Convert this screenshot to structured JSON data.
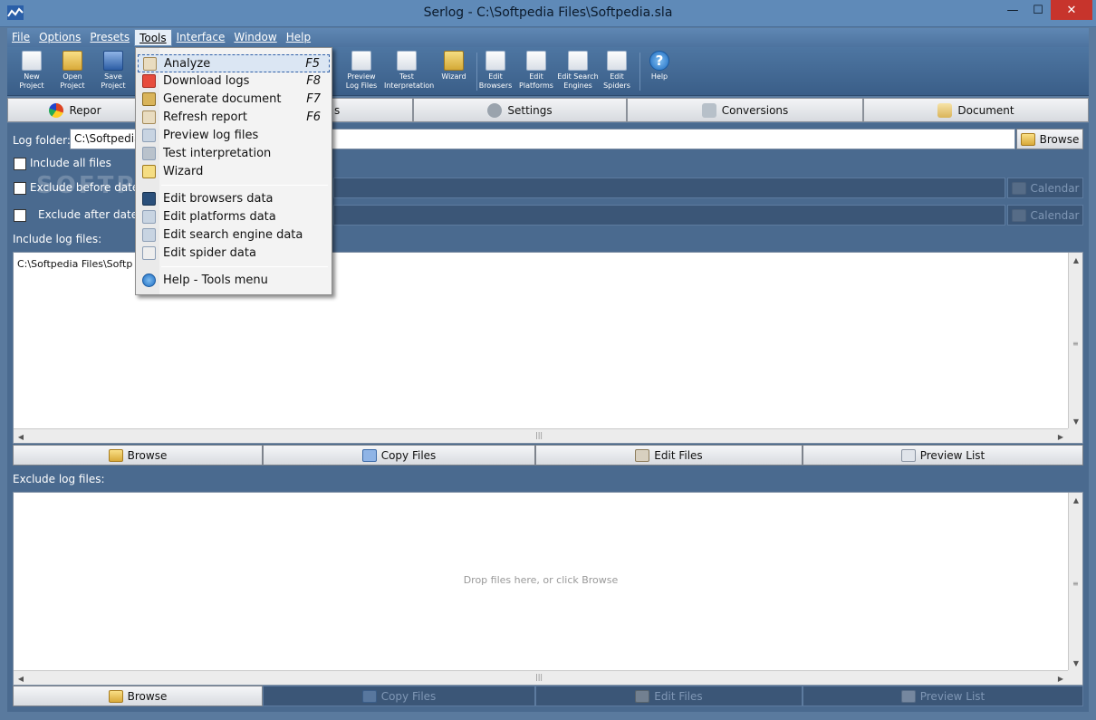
{
  "window": {
    "title": "Serlog - C:\\Softpedia Files\\Softpedia.sla",
    "min": "—",
    "max": "☐",
    "close": "✕"
  },
  "menubar": [
    "File",
    "Options",
    "Presets",
    "Tools",
    "Interface",
    "Window",
    "Help"
  ],
  "toolbar": [
    {
      "label": "New\nProject",
      "icon": "new-project-icon"
    },
    {
      "label": "Open\nProject",
      "icon": "open-folder-icon"
    },
    {
      "label": "Save\nProject",
      "icon": "save-icon"
    },
    {
      "label": "Preview\nLog Files",
      "icon": "preview-icon"
    },
    {
      "label": "Test\nInterpretation",
      "icon": "microscope-icon"
    },
    {
      "label": "Wizard",
      "icon": "wizard-icon"
    },
    {
      "label": "Edit\nBrowsers",
      "icon": "browser-icon"
    },
    {
      "label": "Edit\nPlatforms",
      "icon": "platform-icon"
    },
    {
      "label": "Edit Search\nEngines",
      "icon": "search-engine-icon"
    },
    {
      "label": "Edit\nSpiders",
      "icon": "spider-icon"
    },
    {
      "label": "Help",
      "icon": "help-icon"
    }
  ],
  "tabs": {
    "report": "Repor",
    "logfiles": "s",
    "settings": "Settings",
    "conversions": "Conversions",
    "document": "Document"
  },
  "form": {
    "log_folder_label": "Log folder:",
    "log_folder_value": "C:\\Softpedia",
    "browse": "Browse",
    "include_all": "Include all files",
    "exclude_before": "Exclude before date",
    "exclude_after": "Exclude after date",
    "calendar": "Calendar",
    "include_log_files": "Include log files:",
    "include_list_item": "C:\\Softpedia Files\\Softp",
    "exclude_log_files": "Exclude log files:",
    "drop_hint": "Drop files here, or click Browse"
  },
  "buttons": {
    "browse": "Browse",
    "copy_files": "Copy Files",
    "edit_files": "Edit Files",
    "preview_list": "Preview List"
  },
  "tools_menu": {
    "items": [
      {
        "label": "Analyze",
        "key": "F5",
        "icon": "analyze-icon"
      },
      {
        "label": "Download logs",
        "key": "F8",
        "icon": "download-icon"
      },
      {
        "label": "Generate document",
        "key": "F7",
        "icon": "document-icon"
      },
      {
        "label": "Refresh report",
        "key": "F6",
        "icon": "refresh-icon"
      },
      {
        "label": "Preview log files",
        "key": "",
        "icon": "preview-icon"
      },
      {
        "label": "Test interpretation",
        "key": "",
        "icon": "microscope-icon"
      },
      {
        "label": "Wizard",
        "key": "",
        "icon": "wizard-icon"
      },
      {
        "label": "Edit browsers data",
        "key": "",
        "icon": "browser-icon"
      },
      {
        "label": "Edit platforms data",
        "key": "",
        "icon": "platform-icon"
      },
      {
        "label": "Edit search engine data",
        "key": "",
        "icon": "search-engine-icon"
      },
      {
        "label": "Edit spider data",
        "key": "",
        "icon": "spider-icon"
      },
      {
        "label": "Help - Tools menu",
        "key": "",
        "icon": "help-icon"
      }
    ]
  },
  "watermark": "SOFTPEDIA",
  "colors": {
    "background": "#4a6a8f",
    "titlebar": "#5f8ab8",
    "close": "#c7342c",
    "menu_highlight": "#dbe6f3"
  }
}
